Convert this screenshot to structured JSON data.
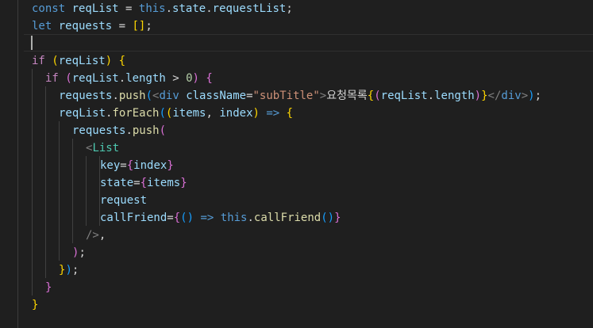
{
  "editor": {
    "lines": [
      {
        "indent": 40,
        "tokens": [
          {
            "t": "const ",
            "c": "kw"
          },
          {
            "t": "reqList",
            "c": "var"
          },
          {
            "t": " = ",
            "c": "txt"
          },
          {
            "t": "this",
            "c": "kw"
          },
          {
            "t": ".",
            "c": "txt"
          },
          {
            "t": "state",
            "c": "var"
          },
          {
            "t": ".",
            "c": "txt"
          },
          {
            "t": "requestList",
            "c": "var"
          },
          {
            "t": ";",
            "c": "txt"
          }
        ]
      },
      {
        "indent": 40,
        "tokens": [
          {
            "t": "let ",
            "c": "kw"
          },
          {
            "t": "requests",
            "c": "var"
          },
          {
            "t": " = ",
            "c": "txt"
          },
          {
            "t": "[]",
            "c": "p1"
          },
          {
            "t": ";",
            "c": "txt"
          }
        ]
      },
      {
        "indent": 40,
        "tokens": []
      },
      {
        "indent": 40,
        "tokens": [
          {
            "t": "if ",
            "c": "ctl"
          },
          {
            "t": "(",
            "c": "p1"
          },
          {
            "t": "reqList",
            "c": "var"
          },
          {
            "t": ")",
            "c": "p1"
          },
          {
            "t": " ",
            "c": "txt"
          },
          {
            "t": "{",
            "c": "p1"
          }
        ]
      },
      {
        "indent": 57,
        "tokens": [
          {
            "t": "if ",
            "c": "ctl"
          },
          {
            "t": "(",
            "c": "p2"
          },
          {
            "t": "reqList",
            "c": "var"
          },
          {
            "t": ".",
            "c": "txt"
          },
          {
            "t": "length",
            "c": "var"
          },
          {
            "t": " > ",
            "c": "txt"
          },
          {
            "t": "0",
            "c": "num"
          },
          {
            "t": ")",
            "c": "p2"
          },
          {
            "t": " ",
            "c": "txt"
          },
          {
            "t": "{",
            "c": "p2"
          }
        ]
      },
      {
        "indent": 74,
        "tokens": [
          {
            "t": "requests",
            "c": "var"
          },
          {
            "t": ".",
            "c": "txt"
          },
          {
            "t": "push",
            "c": "fn"
          },
          {
            "t": "(",
            "c": "p3"
          },
          {
            "t": "<",
            "c": "tag"
          },
          {
            "t": "div",
            "c": "kw"
          },
          {
            "t": " ",
            "c": "txt"
          },
          {
            "t": "className",
            "c": "var"
          },
          {
            "t": "=",
            "c": "txt"
          },
          {
            "t": "\"subTitle\"",
            "c": "str"
          },
          {
            "t": ">",
            "c": "tag"
          },
          {
            "t": "요청목록",
            "c": "txt"
          },
          {
            "t": "{",
            "c": "p1"
          },
          {
            "t": "(",
            "c": "p2"
          },
          {
            "t": "reqList",
            "c": "var"
          },
          {
            "t": ".",
            "c": "txt"
          },
          {
            "t": "length",
            "c": "var"
          },
          {
            "t": ")",
            "c": "p2"
          },
          {
            "t": "}",
            "c": "p1"
          },
          {
            "t": "</",
            "c": "tag"
          },
          {
            "t": "div",
            "c": "kw"
          },
          {
            "t": ">",
            "c": "tag"
          },
          {
            "t": ")",
            "c": "p3"
          },
          {
            "t": ";",
            "c": "txt"
          }
        ]
      },
      {
        "indent": 74,
        "tokens": [
          {
            "t": "reqList",
            "c": "var"
          },
          {
            "t": ".",
            "c": "txt"
          },
          {
            "t": "forEach",
            "c": "fn"
          },
          {
            "t": "(",
            "c": "p3"
          },
          {
            "t": "(",
            "c": "p1"
          },
          {
            "t": "items",
            "c": "var"
          },
          {
            "t": ", ",
            "c": "txt"
          },
          {
            "t": "index",
            "c": "var"
          },
          {
            "t": ")",
            "c": "p1"
          },
          {
            "t": " => ",
            "c": "kw"
          },
          {
            "t": "{",
            "c": "p1"
          }
        ]
      },
      {
        "indent": 91,
        "tokens": [
          {
            "t": "requests",
            "c": "var"
          },
          {
            "t": ".",
            "c": "txt"
          },
          {
            "t": "push",
            "c": "fn"
          },
          {
            "t": "(",
            "c": "p2"
          }
        ]
      },
      {
        "indent": 108,
        "tokens": [
          {
            "t": "<",
            "c": "tag"
          },
          {
            "t": "List",
            "c": "comp"
          }
        ]
      },
      {
        "indent": 126,
        "tokens": [
          {
            "t": "key",
            "c": "var"
          },
          {
            "t": "=",
            "c": "txt"
          },
          {
            "t": "{",
            "c": "p2"
          },
          {
            "t": "index",
            "c": "var"
          },
          {
            "t": "}",
            "c": "p2"
          }
        ]
      },
      {
        "indent": 126,
        "tokens": [
          {
            "t": "state",
            "c": "var"
          },
          {
            "t": "=",
            "c": "txt"
          },
          {
            "t": "{",
            "c": "p2"
          },
          {
            "t": "items",
            "c": "var"
          },
          {
            "t": "}",
            "c": "p2"
          }
        ]
      },
      {
        "indent": 126,
        "tokens": [
          {
            "t": "request",
            "c": "var"
          }
        ]
      },
      {
        "indent": 126,
        "tokens": [
          {
            "t": "callFriend",
            "c": "var"
          },
          {
            "t": "=",
            "c": "txt"
          },
          {
            "t": "{",
            "c": "p2"
          },
          {
            "t": "(",
            "c": "p3"
          },
          {
            "t": ")",
            "c": "p3"
          },
          {
            "t": " => ",
            "c": "kw"
          },
          {
            "t": "this",
            "c": "kw"
          },
          {
            "t": ".",
            "c": "txt"
          },
          {
            "t": "callFriend",
            "c": "fn"
          },
          {
            "t": "(",
            "c": "p3"
          },
          {
            "t": ")",
            "c": "p3"
          },
          {
            "t": "}",
            "c": "p2"
          }
        ]
      },
      {
        "indent": 108,
        "tokens": [
          {
            "t": "/>",
            "c": "tag"
          },
          {
            "t": ",",
            "c": "txt"
          }
        ]
      },
      {
        "indent": 91,
        "tokens": [
          {
            "t": ")",
            "c": "p2"
          },
          {
            "t": ";",
            "c": "txt"
          }
        ]
      },
      {
        "indent": 74,
        "tokens": [
          {
            "t": "}",
            "c": "p1"
          },
          {
            "t": ")",
            "c": "p3"
          },
          {
            "t": ";",
            "c": "txt"
          }
        ]
      },
      {
        "indent": 57,
        "tokens": [
          {
            "t": "}",
            "c": "p2"
          }
        ]
      },
      {
        "indent": 40,
        "tokens": [
          {
            "t": "}",
            "c": "p1"
          }
        ]
      }
    ]
  }
}
